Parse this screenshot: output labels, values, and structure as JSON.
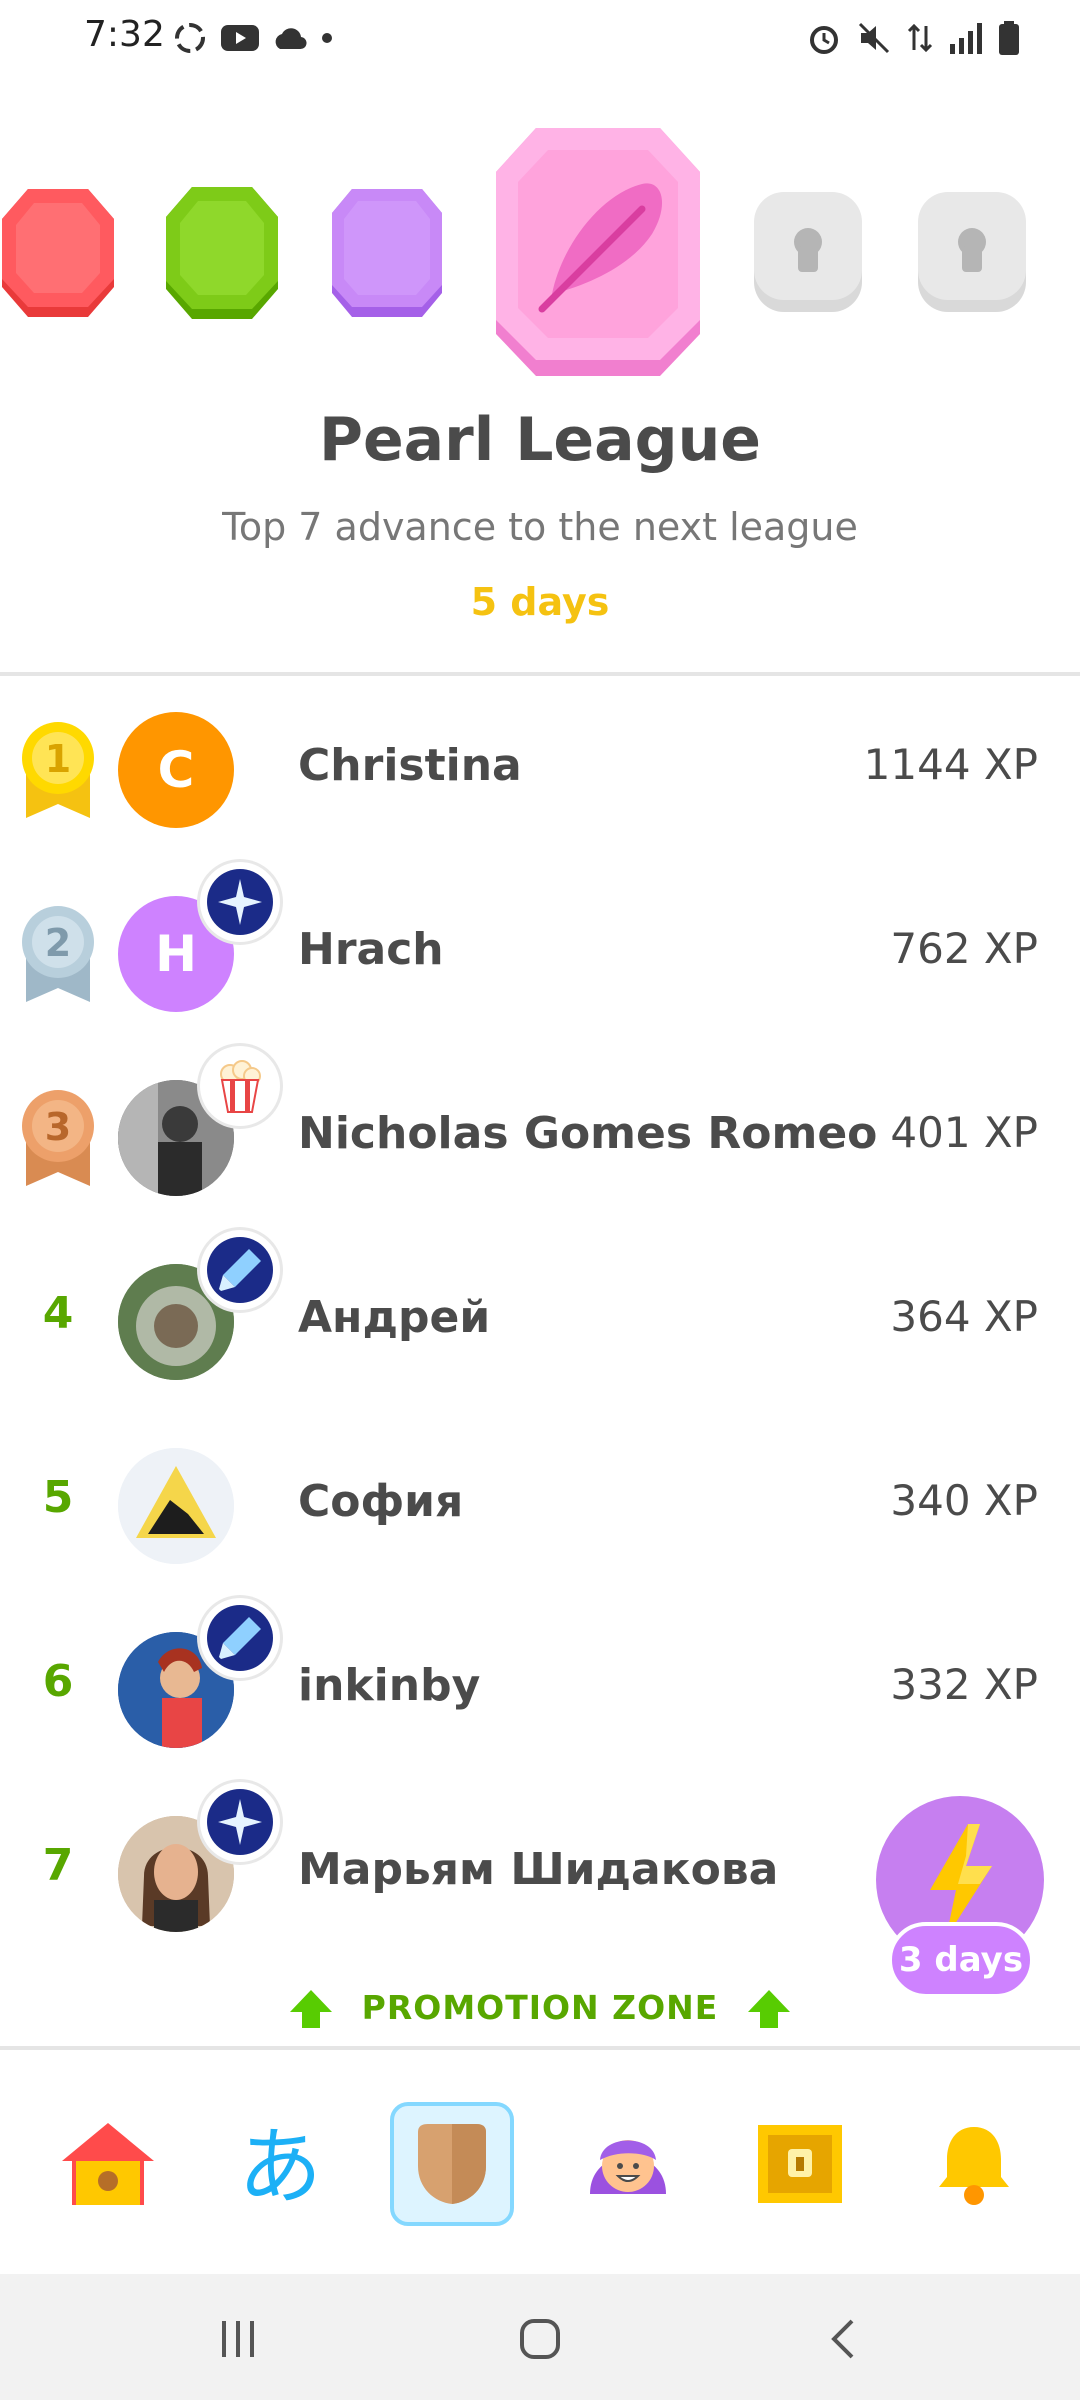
{
  "status_bar": {
    "time": "7:32"
  },
  "league": {
    "title": "Pearl League",
    "subtitle": "Top 7 advance to the next league",
    "time_left": "5 days"
  },
  "leaderboard": [
    {
      "rank": "1",
      "name": "Christina",
      "xp": "1144 XP",
      "avatar_letter": "C",
      "medal": "gold"
    },
    {
      "rank": "2",
      "name": "Hrach",
      "xp": "762 XP",
      "avatar_letter": "H",
      "medal": "silver"
    },
    {
      "rank": "3",
      "name": "Nicholas Gomes Romeo",
      "xp": "401 XP",
      "medal": "bronze"
    },
    {
      "rank": "4",
      "name": "Андрей",
      "xp": "364 XP"
    },
    {
      "rank": "5",
      "name": "София",
      "xp": "340 XP"
    },
    {
      "rank": "6",
      "name": "inkinby",
      "xp": "332 XP"
    },
    {
      "rank": "7",
      "name": "Марьям Шидакова",
      "xp": ""
    }
  ],
  "promotion_zone": {
    "label": "PROMOTION ZONE"
  },
  "boost": {
    "label": "3 days"
  },
  "tabs": [
    "home-icon",
    "characters-icon",
    "leagues-icon",
    "profile-icon",
    "shop-chest-icon",
    "notifications-icon"
  ],
  "colors": {
    "accent_green": "#58a700",
    "gold": "#f5c211",
    "pearl_pink": "#f7a8e0",
    "purple": "#ce82ff"
  }
}
